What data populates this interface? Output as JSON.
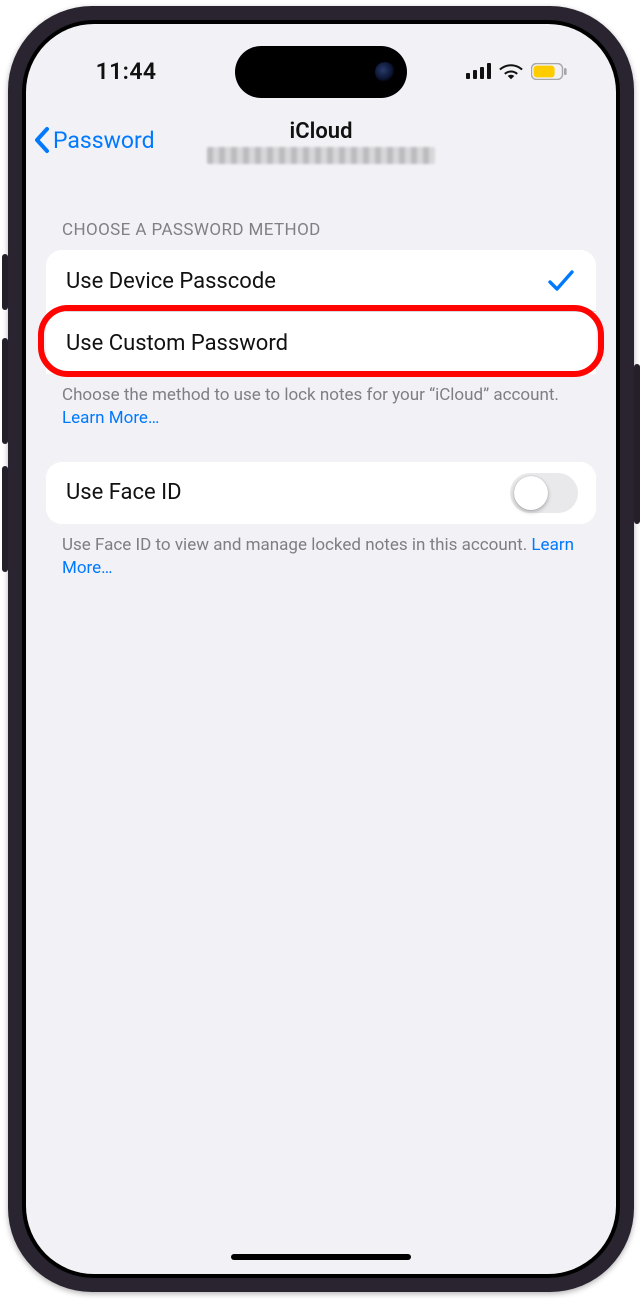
{
  "status": {
    "time": "11:44"
  },
  "nav": {
    "back_label": "Password",
    "title": "iCloud"
  },
  "section1": {
    "header": "CHOOSE A PASSWORD METHOD",
    "option1": "Use Device Passcode",
    "option2": "Use Custom Password",
    "footer_text": "Choose the method to use to lock notes for your “iCloud” account. ",
    "footer_link": "Learn More…"
  },
  "section2": {
    "option1": "Use Face ID",
    "footer_text": "Use Face ID to view and manage locked notes in this account. ",
    "footer_link": "Learn More…"
  }
}
